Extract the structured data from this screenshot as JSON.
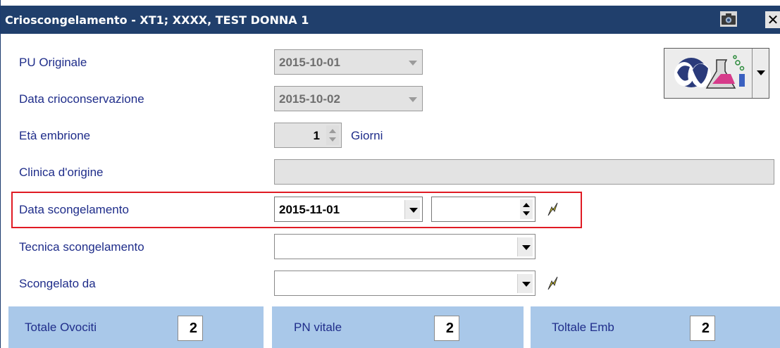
{
  "window": {
    "title": "Crioscongelamento - XT1; XXXX, TEST DONNA 1"
  },
  "form": {
    "pu_originale": {
      "label": "PU Originale",
      "value": "2015-10-01"
    },
    "data_crioconservazione": {
      "label": "Data crioconservazione",
      "value": "2015-10-02"
    },
    "eta_embrione": {
      "label": "Età embrione",
      "value": "1",
      "unit": "Giorni"
    },
    "clinica_origine": {
      "label": "Clinica d'origine",
      "value": ""
    },
    "data_scongelamento": {
      "label": "Data scongelamento",
      "value": "2015-11-01",
      "time_value": ""
    },
    "tecnica_scongelamento": {
      "label": "Tecnica scongelamento",
      "value": ""
    },
    "scongelato_da": {
      "label": "Scongelato da",
      "value": ""
    }
  },
  "summary": [
    {
      "label": "Totale Ovociti",
      "value": "2"
    },
    {
      "label": "PN vitale",
      "value": "2"
    },
    {
      "label": "Toltale Emb",
      "value": "2"
    }
  ],
  "icons": {
    "camera": "camera-icon",
    "close": "close-icon",
    "patients_lab": "patients-lab-icon",
    "bolt": "lightning-icon"
  },
  "colors": {
    "titlebar": "#203f6c",
    "label_text": "#1f2d8a",
    "highlight": "#e01b24",
    "panel": "#a9c8e9"
  }
}
